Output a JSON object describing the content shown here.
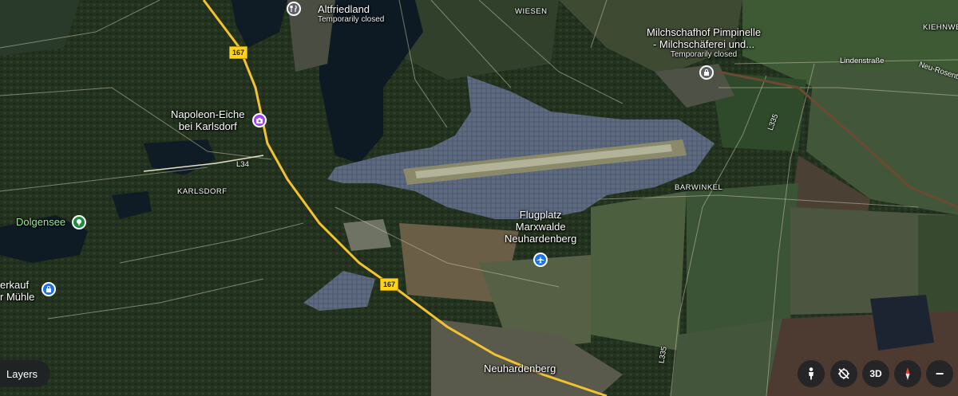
{
  "places": {
    "altfriedland": {
      "name": "Altfriedland",
      "status": "Temporarily closed"
    },
    "milchschafhof": {
      "name_line1": "Milchschafhof Pimpinelle",
      "name_line2": "- Milchschäferei und...",
      "status": "Temporarily closed"
    },
    "napoleon": {
      "name_line1": "Napoleon-Eiche",
      "name_line2": "bei Karlsdorf"
    },
    "dolgensee": {
      "name": "Dolgensee"
    },
    "hofverkauf": {
      "name_line1": "erkauf",
      "name_line2": "r Mühle"
    },
    "flugplatz": {
      "name_line1": "Flugplatz",
      "name_line2": "Marxwalde",
      "name_line3": "Neuhardenberg"
    },
    "neuhardenberg": {
      "name": "Neuhardenberg"
    }
  },
  "localities": {
    "wiesen": "WIESEN",
    "karlsdorf": "KARLSDORF",
    "barwinkel": "BARWINKEL",
    "kiehnwerder": "KIEHNWER"
  },
  "roads": {
    "shield_top": "167",
    "shield_bottom": "167",
    "l34": "L34",
    "l335_top": "L335",
    "l335_bottom": "L335",
    "lindenstrasse": "Lindenstraße",
    "neu_rosenthal": "Neu-Rosenth"
  },
  "controls": {
    "layers_label": "Layers",
    "three_d_label": "3D",
    "zoom_out_label": "−"
  },
  "colors": {
    "highway": "#f2c233",
    "poi_gray": "#5f6368",
    "poi_purple": "#a142f4",
    "poi_green": "#1e8e3e",
    "poi_blue": "#1a73e8",
    "compass_red": "#ea4335"
  },
  "icons": {
    "altfriedland": "restaurant-icon",
    "milchschafhof": "shopping-bag-icon",
    "napoleon": "camera-icon",
    "dolgensee": "park-icon",
    "hofverkauf": "shopping-bag-icon",
    "flugplatz": "airplane-icon"
  }
}
